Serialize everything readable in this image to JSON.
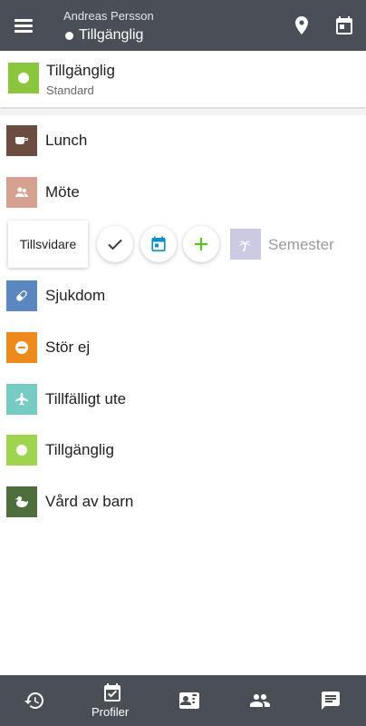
{
  "header": {
    "user_name": "Andreas Persson",
    "status": "Tillgänglig"
  },
  "current_status": {
    "title": "Tillgänglig",
    "subtitle": "Standard",
    "color": "#8cc63f"
  },
  "statuses": [
    {
      "label": "Lunch",
      "color": "#6d4c41",
      "icon": "coffee-icon"
    },
    {
      "label": "Möte",
      "color": "#d7a192",
      "icon": "people-icon"
    },
    {
      "label": "Sjukdom",
      "color": "#5b86c0",
      "icon": "pill-icon"
    },
    {
      "label": "Stör ej",
      "color": "#ec8b1c",
      "icon": "minus-circle-icon"
    },
    {
      "label": "Tillfälligt ute",
      "color": "#76ccc4",
      "icon": "airplane-icon"
    },
    {
      "label": "Tillgänglig",
      "color": "#9fd44c",
      "icon": "dot-icon"
    },
    {
      "label": "Vård av barn",
      "color": "#4f6e3d",
      "icon": "duck-icon"
    }
  ],
  "swipe_row": {
    "duration_label": "Tillsvidare",
    "confirm_icon": "check-icon",
    "schedule_icon": "calendar-icon",
    "add_icon": "plus-icon",
    "status_label": "Semester",
    "status_color": "#ccc9e2",
    "status_icon": "palm-tree-icon"
  },
  "bottom_nav": [
    {
      "name": "history-icon",
      "label": ""
    },
    {
      "name": "profiles-icon",
      "label": "Profiler"
    },
    {
      "name": "contact-card-icon",
      "label": ""
    },
    {
      "name": "group-icon",
      "label": ""
    },
    {
      "name": "chat-icon",
      "label": ""
    }
  ]
}
